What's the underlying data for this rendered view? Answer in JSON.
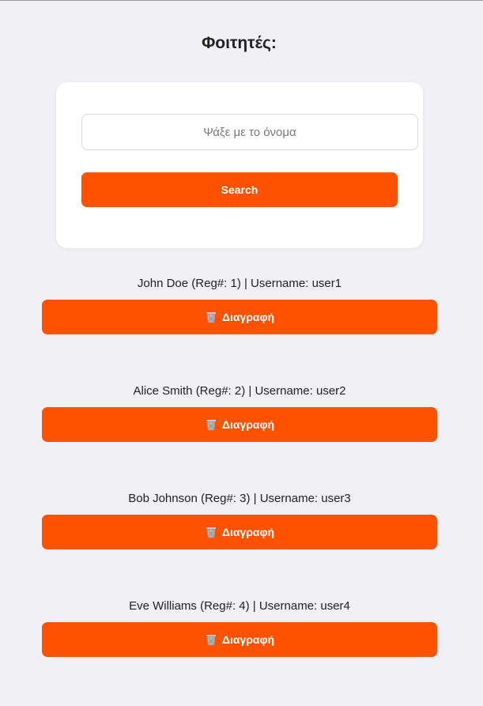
{
  "page": {
    "title": "Φοιτητές:"
  },
  "search": {
    "placeholder": "Ψάξε με το όνομα",
    "value": "",
    "button_label": "Search"
  },
  "students": [
    {
      "text": "John Doe (Reg#: 1) | Username: user1",
      "delete_label": "Διαγραφή"
    },
    {
      "text": "Alice Smith (Reg#: 2) | Username: user2",
      "delete_label": "Διαγραφή"
    },
    {
      "text": "Bob Johnson (Reg#: 3) | Username: user3",
      "delete_label": "Διαγραφή"
    },
    {
      "text": "Eve Williams (Reg#: 4) | Username: user4",
      "delete_label": "Διαγραφή"
    }
  ],
  "icons": {
    "delete": "trash-icon"
  },
  "colors": {
    "accent": "#ff5200",
    "background": "#f0f0f5",
    "card": "#ffffff"
  }
}
